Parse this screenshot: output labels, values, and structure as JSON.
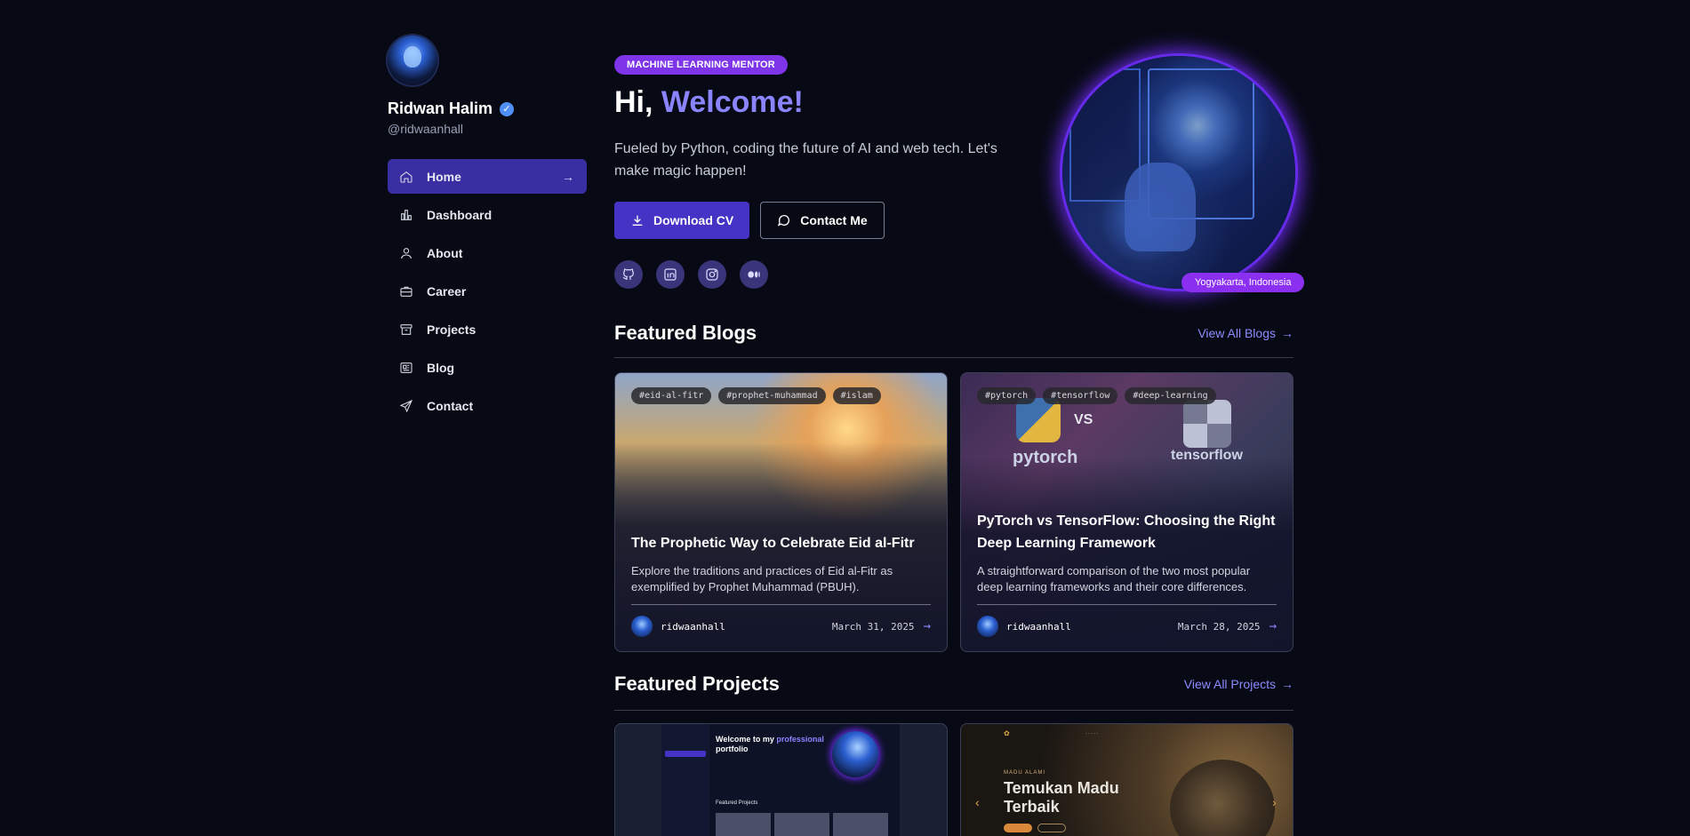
{
  "profile": {
    "name": "Ridwan Halim",
    "handle": "@ridwaanhall"
  },
  "nav": {
    "items": [
      {
        "label": "Home",
        "icon": "home-icon"
      },
      {
        "label": "Dashboard",
        "icon": "chart-icon"
      },
      {
        "label": "About",
        "icon": "user-icon"
      },
      {
        "label": "Career",
        "icon": "briefcase-icon"
      },
      {
        "label": "Projects",
        "icon": "archive-icon"
      },
      {
        "label": "Blog",
        "icon": "newspaper-icon"
      },
      {
        "label": "Contact",
        "icon": "send-icon"
      }
    ],
    "active_arrow": "→"
  },
  "hero": {
    "badge": "MACHINE LEARNING MENTOR",
    "title_prefix": "Hi,",
    "title_accent": "Welcome!",
    "description": "Fueled by Python, coding the future of AI and web tech. Let's make magic happen!",
    "download_label": "Download CV",
    "contact_label": "Contact Me",
    "location": "Yogyakarta, Indonesia",
    "socials": [
      "github-icon",
      "linkedin-icon",
      "instagram-icon",
      "medium-icon"
    ]
  },
  "blogs": {
    "heading": "Featured Blogs",
    "view_all": "View All Blogs",
    "items": [
      {
        "tags": [
          "#eid-al-fitr",
          "#prophet-muhammad",
          "#islam"
        ],
        "title": "The Prophetic Way to Celebrate Eid al-Fitr",
        "excerpt": "Explore the traditions and practices of Eid al-Fitr as exemplified by Prophet Muhammad (PBUH).",
        "author": "ridwaanhall",
        "date": "March 31, 2025"
      },
      {
        "tags": [
          "#pytorch",
          "#tensorflow",
          "#deep-learning"
        ],
        "title": "PyTorch vs TensorFlow: Choosing the Right Deep Learning Framework",
        "excerpt": "A straightforward comparison of the two most popular deep learning frameworks and their core differences.",
        "author": "ridwaanhall",
        "date": "March 28, 2025",
        "image_text": {
          "left": "pytorch",
          "vs": "VS",
          "right": "tensorflow"
        }
      }
    ]
  },
  "projects": {
    "heading": "Featured Projects",
    "view_all": "View All Projects",
    "p1": {
      "title_a": "Welcome to my",
      "title_accent": "professional",
      "title_b": "portfolio",
      "sub": "Featured Projects"
    },
    "p2": {
      "title": "Temukan Madu Terbaik",
      "eyebrow": "MADU ALAMI"
    }
  },
  "colors": {
    "background": "#070a14",
    "accent": "#4433c4",
    "accent_text": "#8b84ff",
    "badge": "#7e34e8"
  }
}
